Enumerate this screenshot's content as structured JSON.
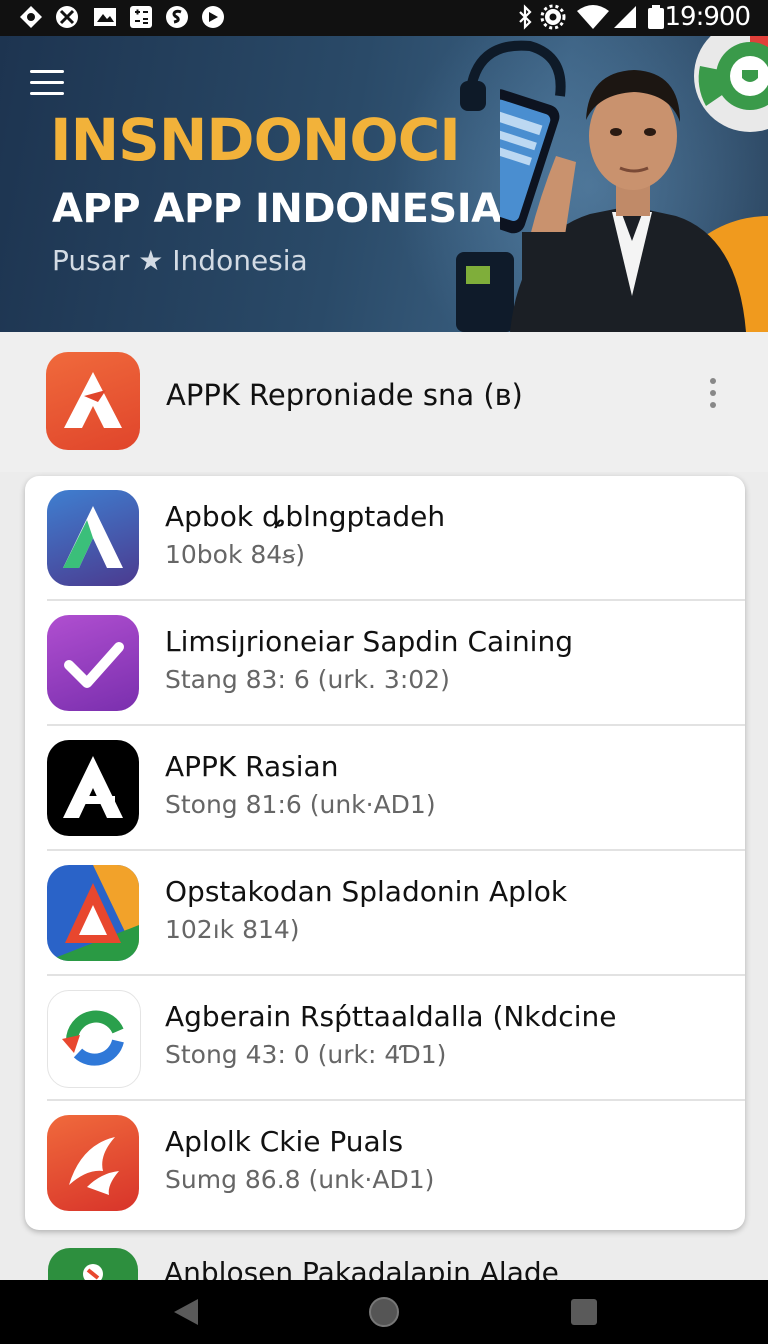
{
  "status_bar": {
    "time": "19:900",
    "left_icons": [
      "android-icon",
      "tools-icon",
      "image-icon",
      "calculator-icon",
      "s-icon",
      "shape-icon"
    ],
    "right_icons": [
      "bluetooth-icon",
      "settings-icon",
      "wifi-icon",
      "signal-icon",
      "battery-icon"
    ]
  },
  "hero": {
    "title": "INSNDONOCI",
    "subtitle": "APP APP INDONESIA",
    "tagline": "Pusar ★ Indonesia",
    "colors": {
      "title": "#f2b23a",
      "background": "#23405e"
    }
  },
  "top_app": {
    "title": "APPK Reproniade sna (ʙ)",
    "icon": "red-a-logo-icon"
  },
  "apps": [
    {
      "name": "Apbok ȡblngptadeh",
      "meta": "10bok 84ꞩ)",
      "icon": "blue-green-a-icon"
    },
    {
      "name": "Limsiȷrioneiar Sapdin Caining",
      "meta": "Stang 83: 6 (urk. 3:02)",
      "icon": "purple-check-icon"
    },
    {
      "name": "APPK Rasian",
      "meta": "Stong 81:6 (unk·AD1)",
      "icon": "black-a-icon"
    },
    {
      "name": "Opstakodan Spladonin Aplok",
      "meta": "102ık 814)",
      "icon": "tricolor-a-icon"
    },
    {
      "name": "Agberain Rsṕttaaldalla (Nkdcine",
      "meta": "Stong 43: 0 (urk: 4Ɗ1)",
      "icon": "swirl-arrow-icon"
    },
    {
      "name": "Aplolk Ckie Puals",
      "meta": "Sumg 86.8 (unk·AD1)",
      "icon": "red-bird-icon"
    }
  ],
  "peek_app": {
    "name": "Anblosen Pakadalapin Alade",
    "icon": "green-app-icon"
  },
  "nav": {
    "back": "back-icon",
    "home": "home-icon",
    "recents": "recents-icon"
  }
}
